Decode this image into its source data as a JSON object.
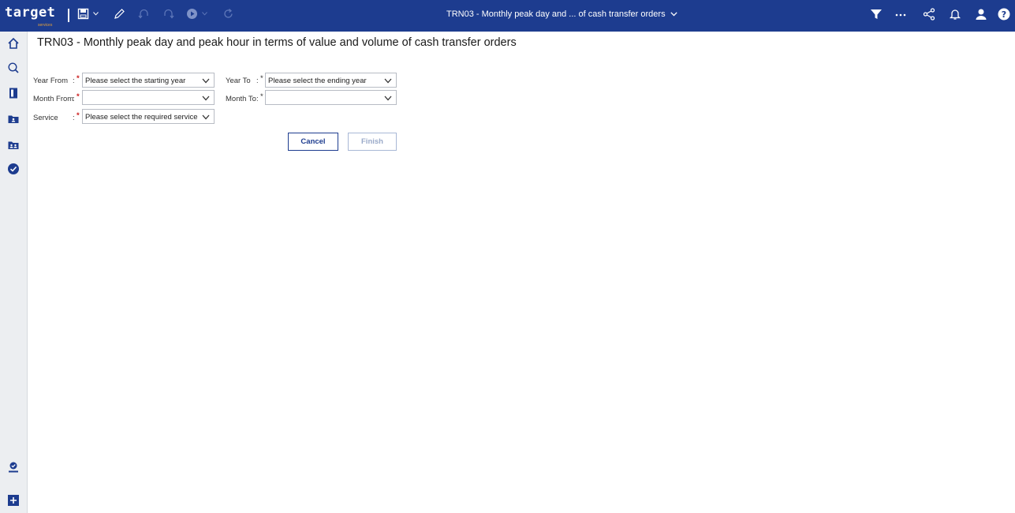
{
  "app": {
    "logo_text": "target",
    "logo_subtext": "services",
    "document_title": "TRN03 - Monthly peak day and ... of cash transfer orders"
  },
  "toolbar": {
    "left_icons": [
      "save-icon",
      "save-dropdown-chevron-icon",
      "edit-pencil-icon",
      "undo-icon",
      "redo-icon",
      "run-icon",
      "run-dropdown-chevron-icon",
      "refresh-icon"
    ],
    "right_icons": [
      "filter-icon",
      "more-options-icon",
      "share-icon",
      "notification-bell-icon",
      "user-profile-icon",
      "help-icon"
    ]
  },
  "sidebar": {
    "items": [
      "home-icon",
      "search-icon",
      "documents-icon",
      "folder-icon",
      "team-folder-icon",
      "check-circle-icon",
      "user-check-icon",
      "add-icon"
    ]
  },
  "page": {
    "title": "TRN03 - Monthly peak day and peak hour in terms of value and volume of cash transfer orders"
  },
  "form": {
    "colon": ":",
    "required_mark": "*",
    "year_from": {
      "label": "Year From",
      "value": "Please select the starting year"
    },
    "year_to": {
      "label": "Year To",
      "value": "Please select the ending year"
    },
    "month_from": {
      "label": "Month From",
      "value": ""
    },
    "month_to": {
      "label": "Month To",
      "value": ""
    },
    "service": {
      "label": "Service",
      "value": "Please select the required service"
    }
  },
  "buttons": {
    "cancel": "Cancel",
    "finish": "Finish"
  },
  "colors": {
    "header_bg": "#1d3c8f",
    "required": "#cc1e1e",
    "accent": "#1d3c8f",
    "finish_disabled": "#9aaac9",
    "logo_subtext": "#e3a03a"
  }
}
